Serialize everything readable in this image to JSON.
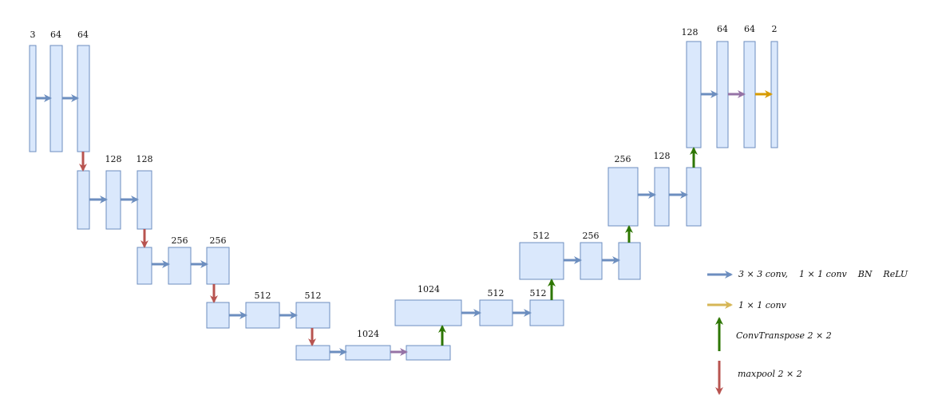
{
  "colors": {
    "block_fill": "#dae8fc",
    "block_stroke": "#6c8ebf",
    "conv_arrow": "#6c8ebf",
    "pool_arrow": "#b85450",
    "upconv_arrow": "#2d7600",
    "purple_arrow": "#9673a6",
    "conv1x1_arrow": "#d79b00",
    "legend_conv1x1_arrow": "#d6b656"
  },
  "labels": {
    "enc1": [
      "3",
      "64",
      "64"
    ],
    "enc2": [
      "128",
      "128"
    ],
    "enc3": [
      "256",
      "256"
    ],
    "enc4": [
      "512",
      "512"
    ],
    "bottleneck": "1024",
    "dec4": [
      "1024",
      "512",
      "512"
    ],
    "dec3": [
      "512",
      "256"
    ],
    "dec2": [
      "256",
      "128"
    ],
    "dec1": [
      "128",
      "64",
      "64",
      "2"
    ]
  },
  "legend": {
    "conv": "3 × 3 conv,    1 × 1 conv    BN    ReLU",
    "conv1x1": "1 × 1 conv",
    "upconv": "ConvTranspose 2 × 2",
    "maxpool": "maxpool 2 × 2"
  }
}
